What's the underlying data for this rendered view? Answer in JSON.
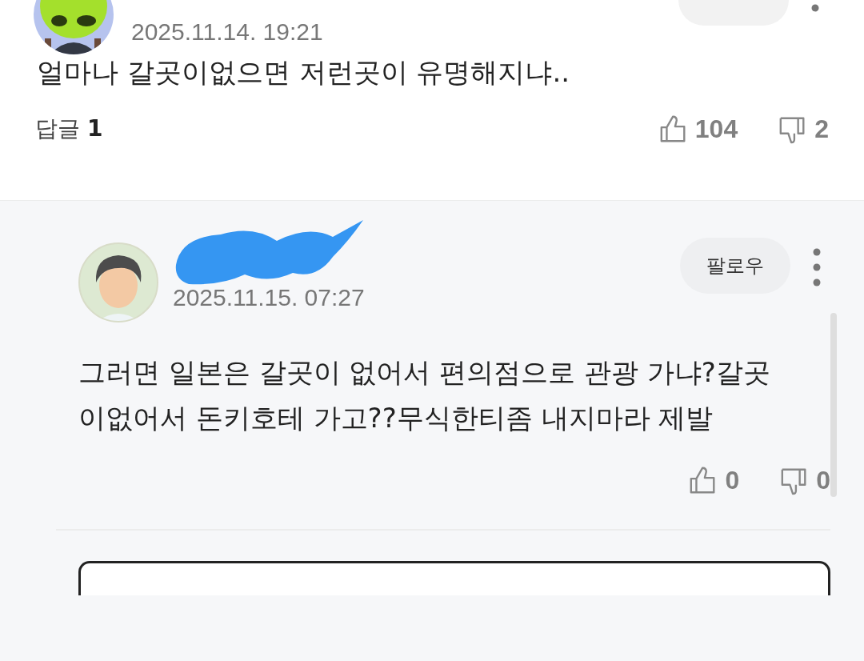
{
  "comment": {
    "date": "2025.11.14. 19:21",
    "text": "얼마나 갈곳이없으면 저런곳이 유명해지냐..",
    "reply_label": "답글",
    "reply_count": "1",
    "likes": "104",
    "dislikes": "2"
  },
  "reply": {
    "follow": "팔로우",
    "date": "2025.11.15. 07:27",
    "text": "그러면 일본은 갈곳이 없어서 편의점으로 관광 가냐?갈곳이없어서 돈키호테 가고??무식한티좀 내지마라 제발",
    "likes": "0",
    "dislikes": "0"
  }
}
